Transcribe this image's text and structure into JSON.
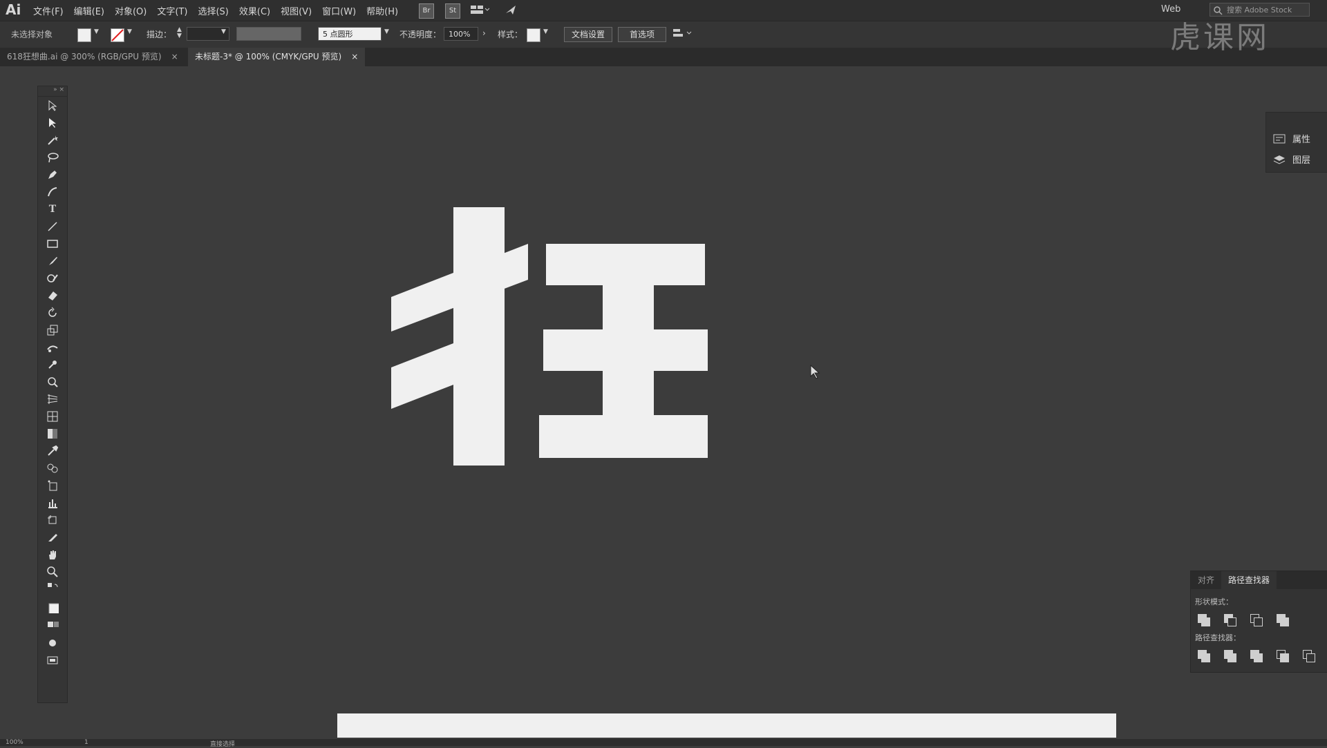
{
  "app": {
    "logo": "Ai"
  },
  "menus": [
    "文件(F)",
    "编辑(E)",
    "对象(O)",
    "文字(T)",
    "选择(S)",
    "效果(C)",
    "视图(V)",
    "窗口(W)",
    "帮助(H)"
  ],
  "menubar_icons": {
    "br": "Br",
    "st": "St"
  },
  "workspace": "Web",
  "search_placeholder": "搜索 Adobe Stock",
  "control": {
    "selection_status": "未选择对象",
    "stroke_label": "描边：",
    "brush": "5 点圆形",
    "opacity_label": "不透明度：",
    "opacity_value": "100%",
    "style_label": "样式：",
    "doc_setup": "文档设置",
    "preferences": "首选项"
  },
  "tabs": [
    {
      "label": "618狂想曲.ai @ 300% (RGB/GPU 预览)",
      "active": false
    },
    {
      "label": "未标题-3* @ 100% (CMYK/GPU 预览)",
      "active": true
    }
  ],
  "right_panel": {
    "properties": "属性",
    "layers": "图层"
  },
  "pathfinder": {
    "tab_align": "对齐",
    "tab_pathfinder": "路径查找器",
    "shape_modes_label": "形状模式：",
    "pathfinders_label": "路径查找器："
  },
  "status": {
    "zoom": "100%",
    "page": "1",
    "tool": "直接选择"
  },
  "watermark": "虎课网",
  "colors": {
    "bg": "#3c3c3c",
    "glyph": "#f0f0f0",
    "panel": "#353535"
  }
}
